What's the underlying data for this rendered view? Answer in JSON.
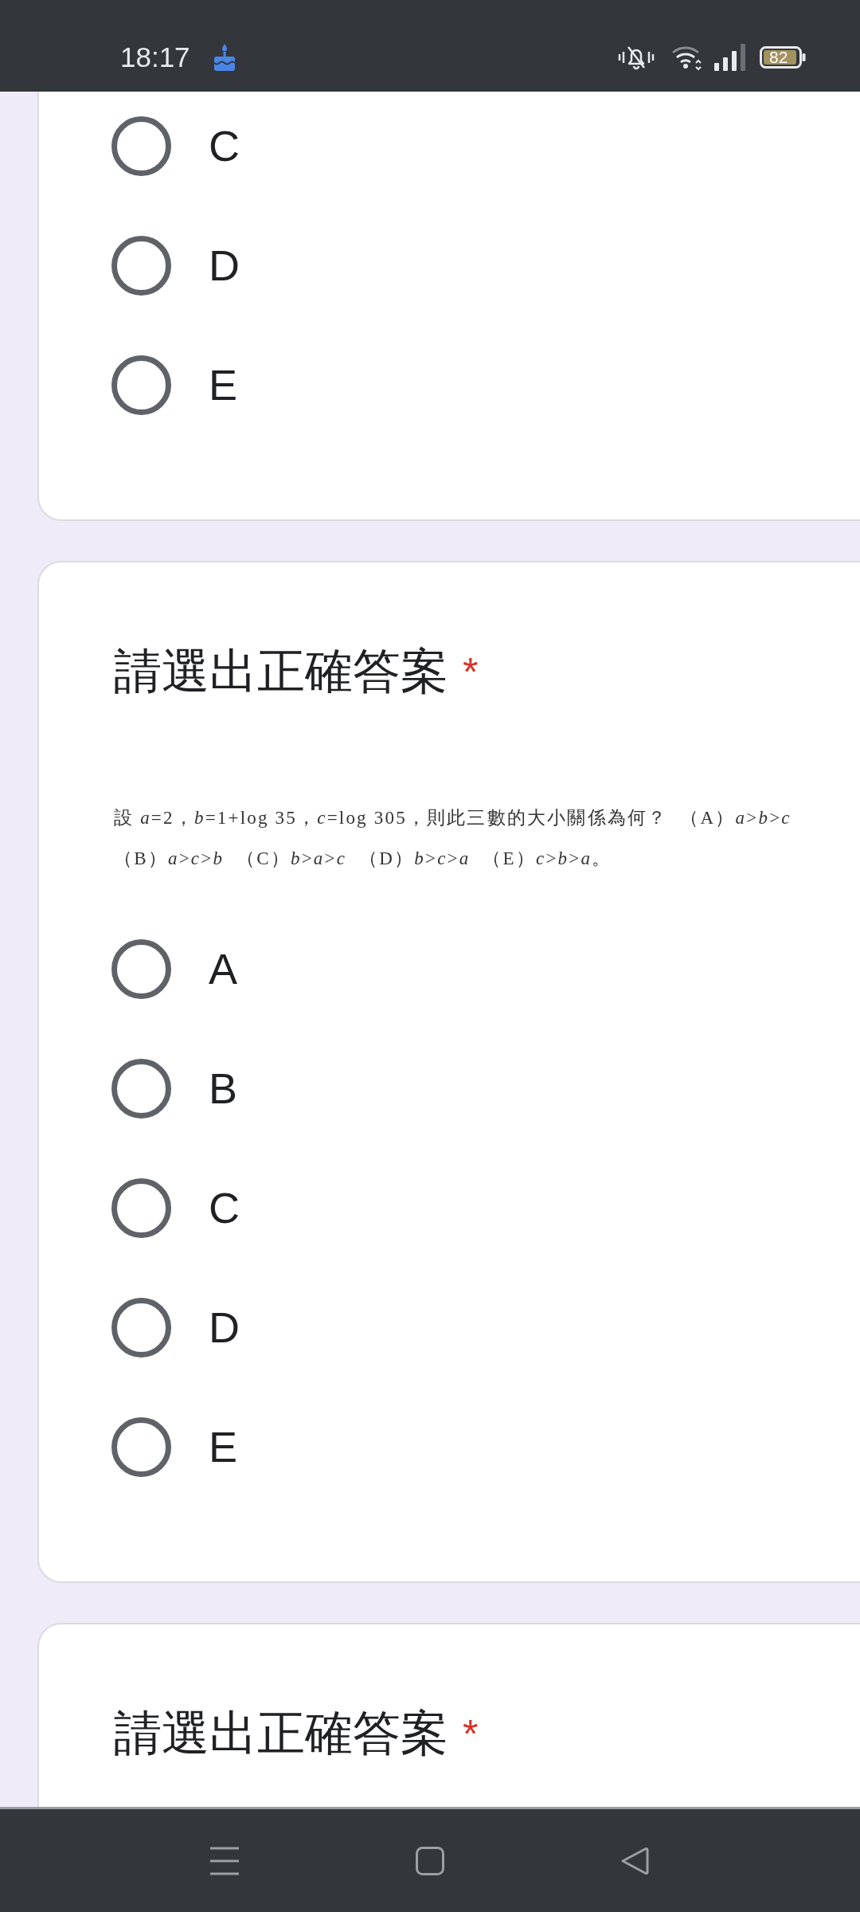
{
  "status_bar": {
    "time": "18:17",
    "battery": "82"
  },
  "questions": [
    {
      "options": [
        {
          "label": "C",
          "selected": false
        },
        {
          "label": "D",
          "selected": false
        },
        {
          "label": "E",
          "selected": false
        }
      ]
    },
    {
      "title": "請選出正確答案",
      "required_mark": "*",
      "question_text": "設 *a*=2，*b*=1+log 35，*c*=log 305，則此三數的大小關係為何？  （A）*a*>*b*>*c*\n（B）*a*>*c*>*b*  （C）*b*>*a*>*c*  （D）*b*>*c*>*a*  （E）*c*>*b*>*a*。",
      "options": [
        {
          "label": "A",
          "selected": false
        },
        {
          "label": "B",
          "selected": false
        },
        {
          "label": "C",
          "selected": false
        },
        {
          "label": "D",
          "selected": false
        },
        {
          "label": "E",
          "selected": false
        }
      ]
    },
    {
      "title": "請選出正確答案",
      "required_mark": "*"
    }
  ]
}
